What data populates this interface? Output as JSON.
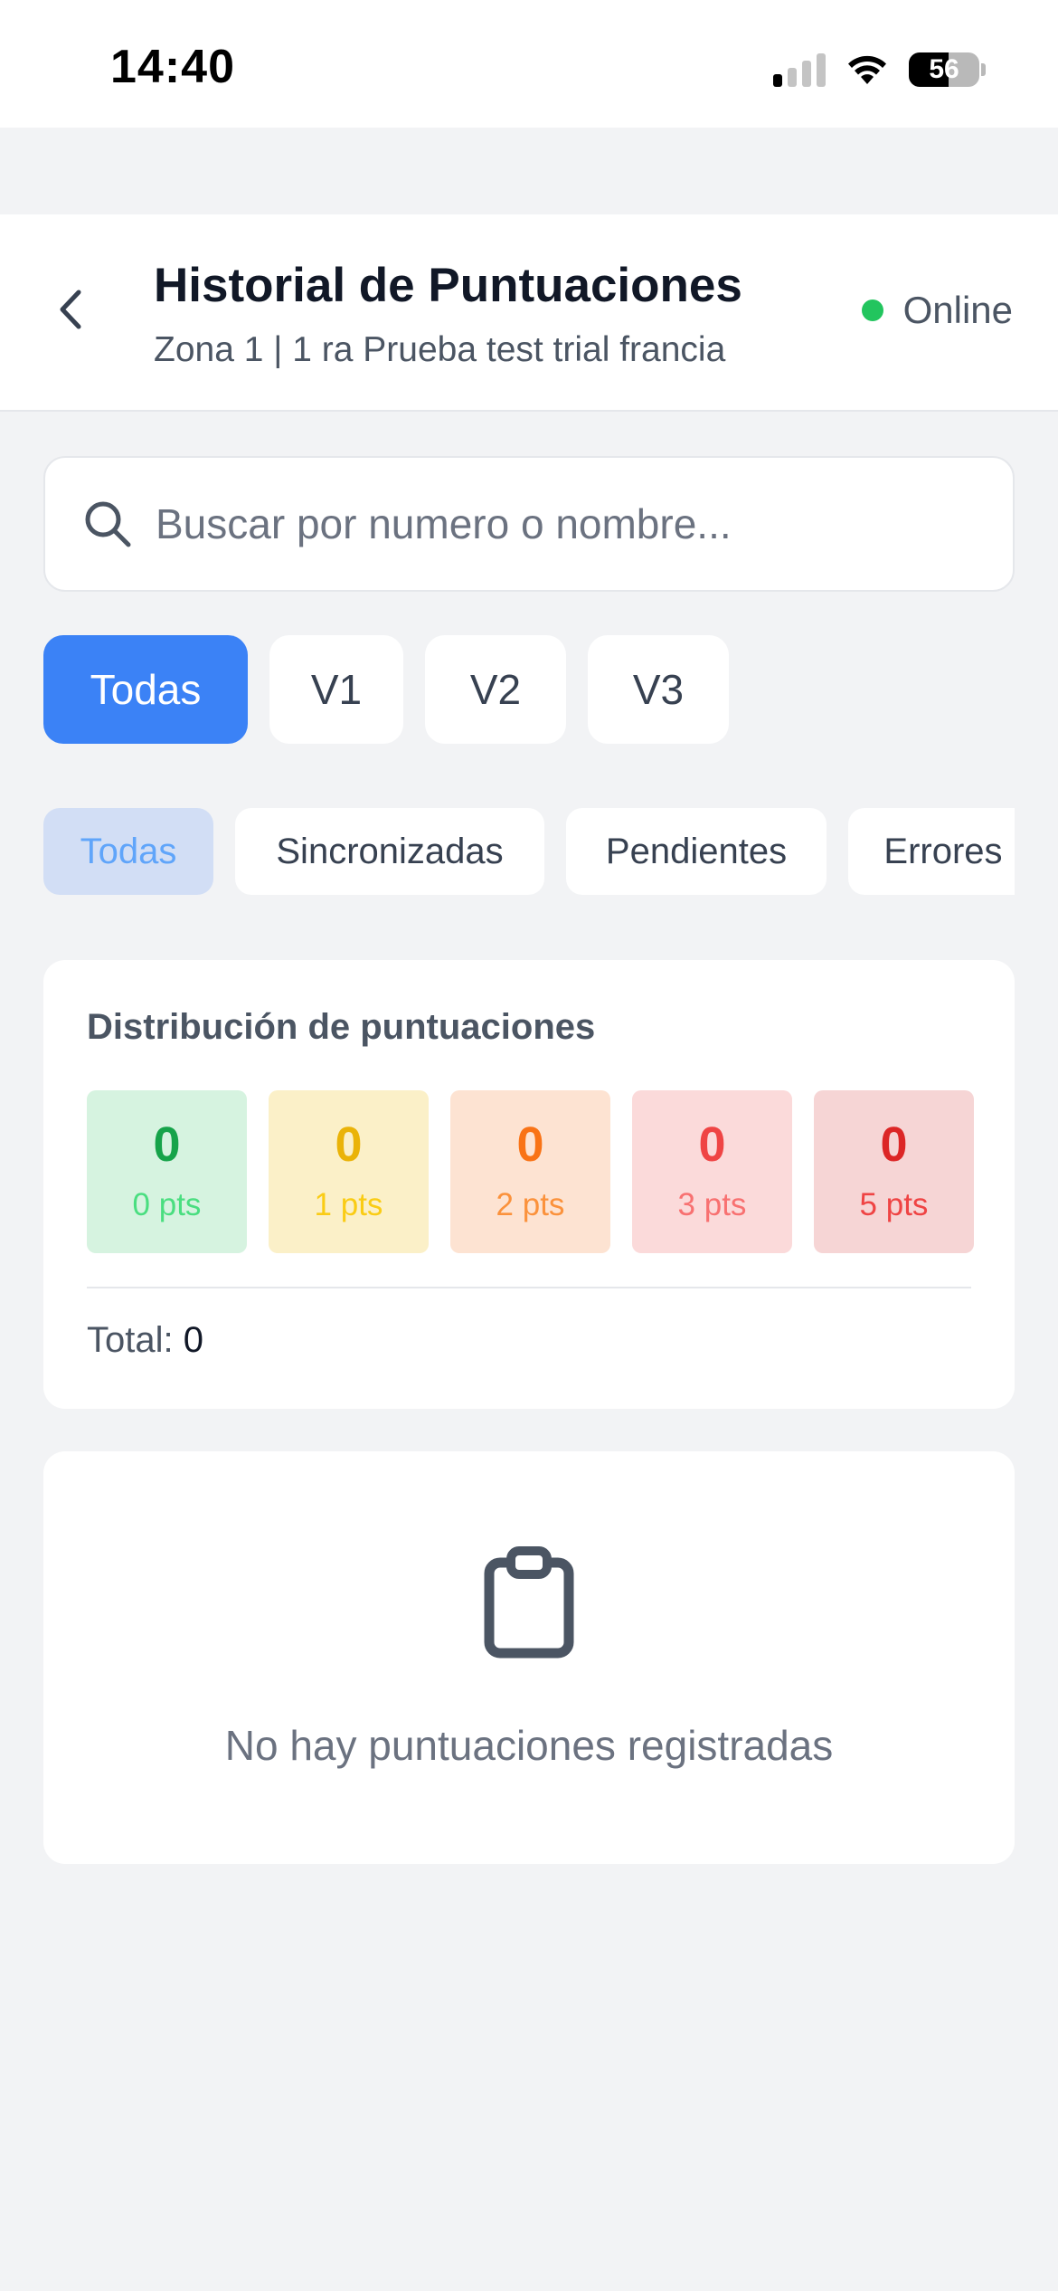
{
  "status_bar": {
    "time": "14:40",
    "battery": "56"
  },
  "header": {
    "title": "Historial de Puntuaciones",
    "subtitle": "Zona 1 | 1 ra Prueba test trial francia",
    "connection": "Online"
  },
  "search": {
    "placeholder": "Buscar por numero o nombre...",
    "value": ""
  },
  "round_tabs": [
    {
      "label": "Todas",
      "active": true
    },
    {
      "label": "V1",
      "active": false
    },
    {
      "label": "V2",
      "active": false
    },
    {
      "label": "V3",
      "active": false
    }
  ],
  "status_filters": [
    {
      "label": "Todas",
      "active": true
    },
    {
      "label": "Sincronizadas",
      "active": false
    },
    {
      "label": "Pendientes",
      "active": false
    },
    {
      "label": "Errores",
      "active": false
    }
  ],
  "distribution": {
    "title": "Distribución de puntuaciones",
    "buckets": [
      {
        "count": "0",
        "label": "0 pts",
        "bg": "#d6f3e0",
        "count_color": "#16a34a",
        "label_color": "#4ade80"
      },
      {
        "count": "0",
        "label": "1 pts",
        "bg": "#fbf0c8",
        "count_color": "#eab308",
        "label_color": "#facc15"
      },
      {
        "count": "0",
        "label": "2 pts",
        "bg": "#fde3d2",
        "count_color": "#f97316",
        "label_color": "#fb923c"
      },
      {
        "count": "0",
        "label": "3 pts",
        "bg": "#fbdada",
        "count_color": "#ef4444",
        "label_color": "#f87171"
      },
      {
        "count": "0",
        "label": "5 pts",
        "bg": "#f6d5d5",
        "count_color": "#dc2626",
        "label_color": "#ef4444"
      }
    ],
    "total_label": "Total:",
    "total_value": "0"
  },
  "empty_state": {
    "icon": "clipboard-icon",
    "message": "No hay puntuaciones registradas"
  },
  "colors": {
    "accent": "#3b82f6",
    "online": "#22c55e",
    "background": "#f2f3f5"
  }
}
